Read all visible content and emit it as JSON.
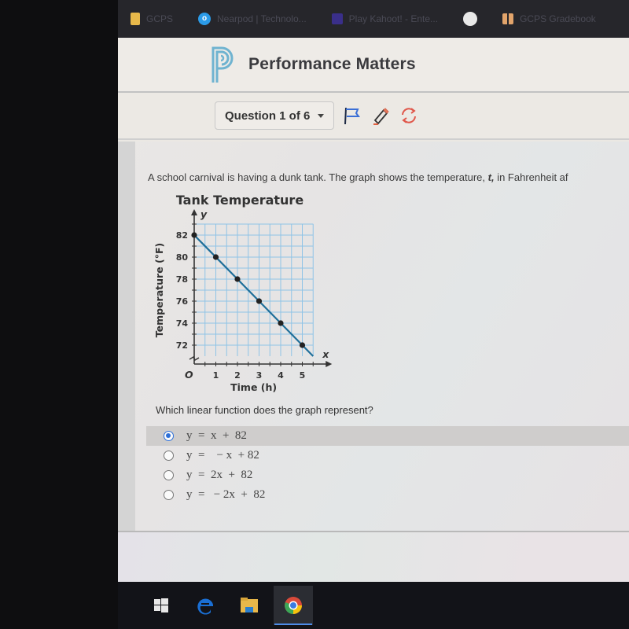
{
  "bookmarks": [
    {
      "label": "GCPS",
      "icon": "folder-icon"
    },
    {
      "label": "Nearpod | Technolo...",
      "icon": "nearpod-icon"
    },
    {
      "label": "Play Kahoot! - Ente...",
      "icon": "kahoot-icon"
    },
    {
      "label": "",
      "icon": "globe-icon"
    },
    {
      "label": "GCPS Gradebook",
      "icon": "apps-icon"
    }
  ],
  "header": {
    "brand": "Performance Matters",
    "logo_letter": "P"
  },
  "toolbar": {
    "question_select": "Question 1 of 6",
    "flag_icon": "flag-icon",
    "pencil_icon": "pencil-icon",
    "refresh_icon": "refresh-icon"
  },
  "question": {
    "prompt_before": "A school carnival is having a dunk tank.  The graph shows the temperature, ",
    "prompt_var": "t,",
    "prompt_after": " in Fahrenheit af",
    "ask": "Which linear function does the graph represent?",
    "options": [
      {
        "label": "y  =  x  +  82",
        "selected": true
      },
      {
        "label": "y  =    − x  + 82",
        "selected": false
      },
      {
        "label": "y  =  2x  +  82",
        "selected": false
      },
      {
        "label": "y  =   − 2x  +  82",
        "selected": false
      }
    ]
  },
  "chart_data": {
    "type": "line",
    "title": "Tank Temperature",
    "xlabel": "Time (h)",
    "ylabel": "Temperature (°F)",
    "x_axis_letter": "x",
    "y_axis_letter": "y",
    "origin_label": "O",
    "x": [
      0,
      1,
      2,
      3,
      4,
      5
    ],
    "series": [
      {
        "name": "Temperature",
        "values": [
          82,
          80,
          78,
          76,
          74,
          72
        ]
      }
    ],
    "line_extends_to_x": 5.5,
    "xticks": [
      1,
      2,
      3,
      4,
      5
    ],
    "yticks": [
      72,
      74,
      76,
      78,
      80,
      82
    ],
    "xlim": [
      0,
      5.5
    ],
    "ylim": [
      71,
      83
    ],
    "y_axis_break": true,
    "grid": true,
    "colors": {
      "line": "#1f6f9a",
      "grid": "#8fc3e6",
      "point": "#222222"
    }
  },
  "taskbar": [
    {
      "icon": "windows-start-icon",
      "active": false
    },
    {
      "icon": "edge-icon",
      "active": false
    },
    {
      "icon": "file-explorer-icon",
      "active": false
    },
    {
      "icon": "chrome-icon",
      "active": true
    }
  ]
}
